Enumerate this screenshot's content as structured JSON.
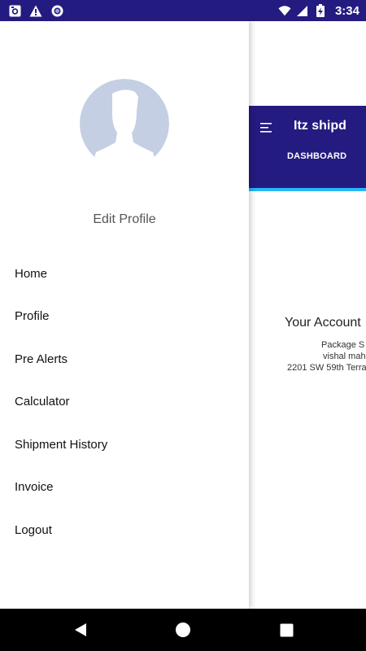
{
  "status_bar": {
    "time": "3:34",
    "icons": [
      "camera-notification-icon",
      "warning-icon",
      "circle-notification-icon",
      "wifi-icon",
      "signal-icon",
      "battery-charging-icon"
    ]
  },
  "app": {
    "title": "Itz shipd",
    "tab": "DASHBOARD",
    "account_title": "Your Account",
    "account_lines": [
      "Package S",
      "vishal mah",
      "2201 SW 59th Terra"
    ]
  },
  "drawer": {
    "edit_profile": "Edit Profile",
    "items": [
      "Home",
      "Profile",
      "Pre Alerts",
      "Calculator",
      "Shipment History",
      "Invoice",
      "Logout"
    ]
  },
  "colors": {
    "primary": "#241b80",
    "accent": "#29b6f6",
    "avatar": "#c5cfe3"
  }
}
